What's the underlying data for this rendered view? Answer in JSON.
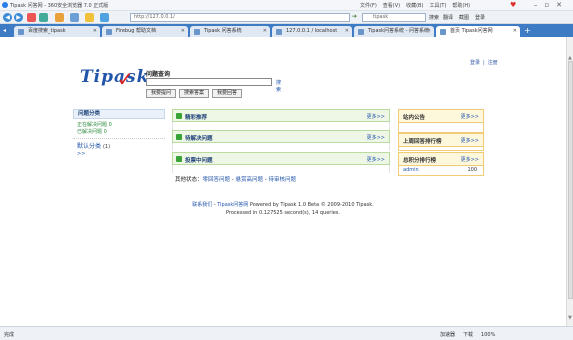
{
  "browser": {
    "window_title": "Tipask 问答网 - 360安全浏览器 7.0 正式版",
    "menu": [
      "文件(F)",
      "查看(V)",
      "收藏(B)",
      "工具(T)",
      "帮助(H)"
    ],
    "address": "http://127.0.0.1/",
    "search_placeholder": "tipask",
    "search_label": "搜索",
    "toolbar_right": [
      "翻译",
      "截图",
      "登录"
    ],
    "tabs": [
      {
        "label": "百度搜索_tipask"
      },
      {
        "label": "Firebug 帮助文档"
      },
      {
        "label": "Tipask 问答系统"
      },
      {
        "label": "127.0.0.1 / localhost"
      },
      {
        "label": "Tipask问答系统 - 问答系统"
      },
      {
        "label": "首页 Tipask问答网"
      }
    ],
    "status_left": "完成",
    "status_right": [
      "加速器",
      "下载",
      "100%"
    ]
  },
  "header": {
    "login_label": "登录",
    "register_label": "注册",
    "logo_text": "Tipask",
    "search_label": "问题查询",
    "search_value": "",
    "go_label": "搜索",
    "buttons": [
      "我要提问",
      "搜索答案",
      "我要回答"
    ]
  },
  "sidebar": {
    "title": "问题分类",
    "items": [
      "正在解决问题 0",
      "已解决问题 0"
    ],
    "category": "默认分类",
    "category_count": "(1)",
    "sub": ">>"
  },
  "center": {
    "boxes": [
      {
        "title": "精彩推荐",
        "more": "更多>>"
      },
      {
        "title": "待解决问题",
        "more": "更多>>"
      },
      {
        "title": "投票中问题",
        "more": "更多>>"
      }
    ],
    "quick_prefix": "其他状态：",
    "quick_links": [
      "零回答问题",
      "悬赏高问题",
      "待审核问题"
    ],
    "quick_sep": " - "
  },
  "right": {
    "notice": {
      "title": "站内公告",
      "more": "更多>>"
    },
    "rank": {
      "title": "上周回答排行榜",
      "more": "更多>>"
    },
    "total": {
      "title": "总积分排行榜",
      "more": "更多>>",
      "rows": [
        {
          "name": "admin",
          "value": "100"
        }
      ]
    }
  },
  "footer": {
    "line1_links": [
      "联系我们",
      "Tipask问答网"
    ],
    "line1_powered": "Powered by Tipask 1.0 Beta © 2009-2010 Tipask.",
    "line2": "Processed in 0.127525 second(s), 14 queries."
  },
  "colors": {
    "tabbar": "#3d7bc4",
    "link": "#2255aa",
    "box_green": "#eef7e6",
    "box_yellow": "#fdf7dc",
    "logo_check": "#dd2222"
  }
}
